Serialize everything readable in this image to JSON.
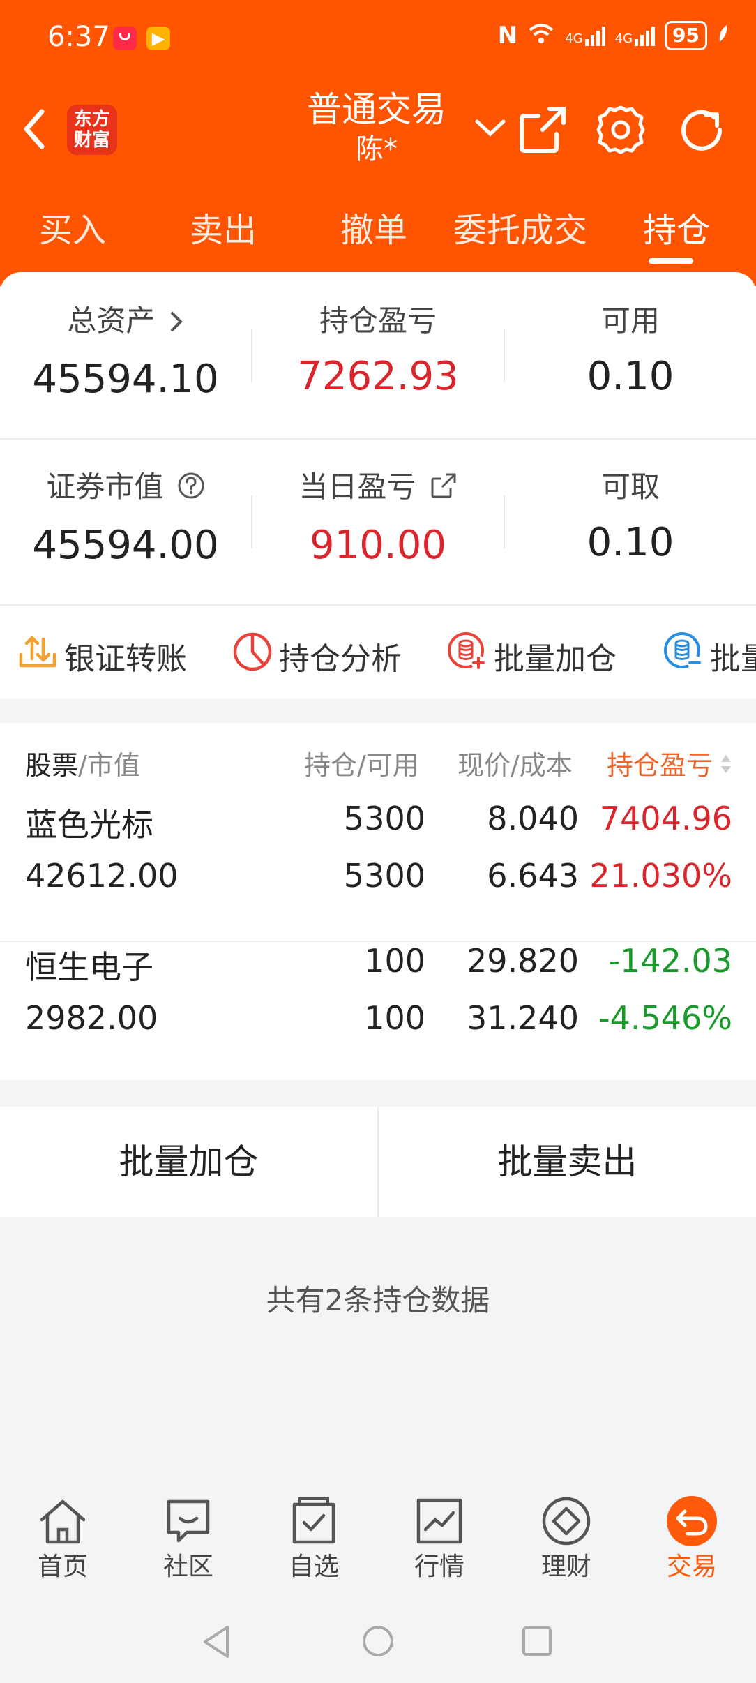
{
  "status_bar": {
    "time": "6:37",
    "battery": "95",
    "signal_1": "4G",
    "signal_2": "4G",
    "network_type": "6"
  },
  "header": {
    "logo_line1": "东方",
    "logo_line2": "财富",
    "title": "普通交易",
    "account": "陈*"
  },
  "tabs": [
    {
      "label": "买入"
    },
    {
      "label": "卖出"
    },
    {
      "label": "撤单"
    },
    {
      "label": "委托成交"
    },
    {
      "label": "持仓"
    }
  ],
  "summary": {
    "total_assets": {
      "label": "总资产",
      "value": "45594.10"
    },
    "position_pnl": {
      "label": "持仓盈亏",
      "value": "7262.93"
    },
    "available": {
      "label": "可用",
      "value": "0.10"
    },
    "market_value": {
      "label": "证券市值",
      "value": "45594.00"
    },
    "daily_pnl": {
      "label": "当日盈亏",
      "value": "910.00"
    },
    "withdrawable": {
      "label": "可取",
      "value": "0.10"
    }
  },
  "quick_actions": [
    {
      "label": "银证转账",
      "icon": "upload-transfer-icon"
    },
    {
      "label": "持仓分析",
      "icon": "pie-chart-icon"
    },
    {
      "label": "批量加仓",
      "icon": "batch-add-icon"
    },
    {
      "label": "批量",
      "icon": "batch-sell-icon"
    }
  ],
  "holdings_table": {
    "headers": {
      "stock": "股票",
      "stock_sub": "/市值",
      "position": "持仓/可用",
      "price": "现价/成本",
      "pnl": "持仓盈亏"
    },
    "rows": [
      {
        "name": "蓝色光标",
        "market_value": "42612.00",
        "position": "5300",
        "available": "5300",
        "price": "8.040",
        "cost": "6.643",
        "pnl": "7404.96",
        "pnl_pct": "21.030%"
      },
      {
        "name": "恒生电子",
        "market_value": "2982.00",
        "position": "100",
        "available": "100",
        "price": "29.820",
        "cost": "31.240",
        "pnl": "-142.03",
        "pnl_pct": "-4.546%"
      }
    ]
  },
  "batch_buttons": {
    "add": "批量加仓",
    "sell": "批量卖出"
  },
  "count_text": "共有2条持仓数据",
  "bottom_nav": [
    {
      "label": "首页",
      "icon": "home-icon"
    },
    {
      "label": "社区",
      "icon": "community-icon"
    },
    {
      "label": "自选",
      "icon": "watchlist-icon"
    },
    {
      "label": "行情",
      "icon": "market-icon"
    },
    {
      "label": "理财",
      "icon": "wealth-icon"
    },
    {
      "label": "交易",
      "icon": "trade-icon"
    }
  ],
  "colors": {
    "brand": "#ff5500",
    "gain": "#d9262c",
    "loss": "#1a9a2a",
    "sort_active": "#f0642a"
  }
}
